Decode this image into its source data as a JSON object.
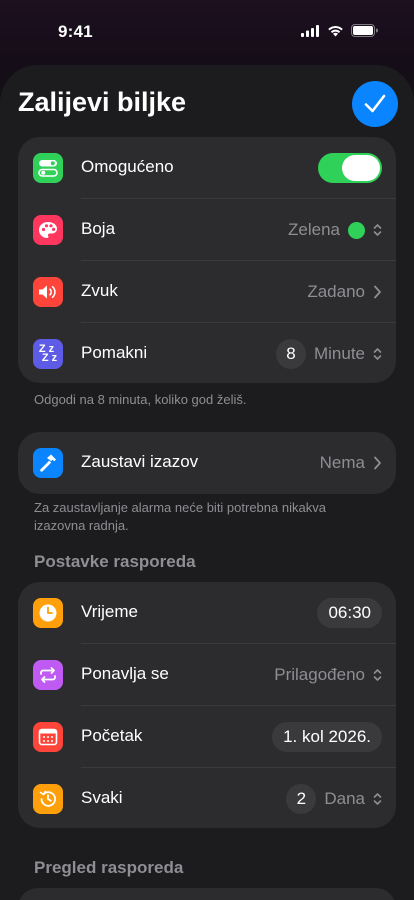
{
  "status_bar": {
    "time": "9:41"
  },
  "header": {
    "title": "Zalijevi biljke"
  },
  "alarm_group": {
    "enabled": {
      "label": "Omogućeno",
      "on": true
    },
    "color": {
      "label": "Boja",
      "value": "Zelena",
      "dot_color": "#30d158"
    },
    "sound": {
      "label": "Zvuk",
      "value": "Zadano"
    },
    "snooze": {
      "label": "Pomakni",
      "count": "8",
      "unit": "Minute"
    }
  },
  "snooze_footnote": "Odgodi na 8 minuta, koliko god želiš.",
  "challenge": {
    "label": "Zaustavi izazov",
    "value": "Nema"
  },
  "challenge_footnote": "Za zaustavljanje alarma neće biti potrebna nikakva izazovna radnja.",
  "schedule": {
    "header": "Postavke rasporeda",
    "time": {
      "label": "Vrijeme",
      "value": "06:30"
    },
    "repeat": {
      "label": "Ponavlja se",
      "value": "Prilagođeno"
    },
    "start": {
      "label": "Početak",
      "value": "1. kol 2026."
    },
    "every": {
      "label": "Svaki",
      "count": "2",
      "unit": "Dana"
    }
  },
  "preview": {
    "header": "Pregled rasporeda"
  },
  "icons": {
    "enabled": "toggle-icon",
    "color": "palette-icon",
    "sound": "speaker-icon",
    "snooze": "zzz-icon",
    "challenge": "hammer-icon",
    "time": "clock-icon",
    "repeat": "repeat-icon",
    "start": "calendar-icon",
    "every": "history-icon"
  },
  "colors": {
    "accent": "#0a84ff",
    "green": "#30d158",
    "red": "#ff453a",
    "pink": "#ff375f",
    "indigo": "#5e5ce6",
    "orange": "#ff9f0a",
    "purple": "#bf5af2",
    "blue": "#0a84ff"
  }
}
